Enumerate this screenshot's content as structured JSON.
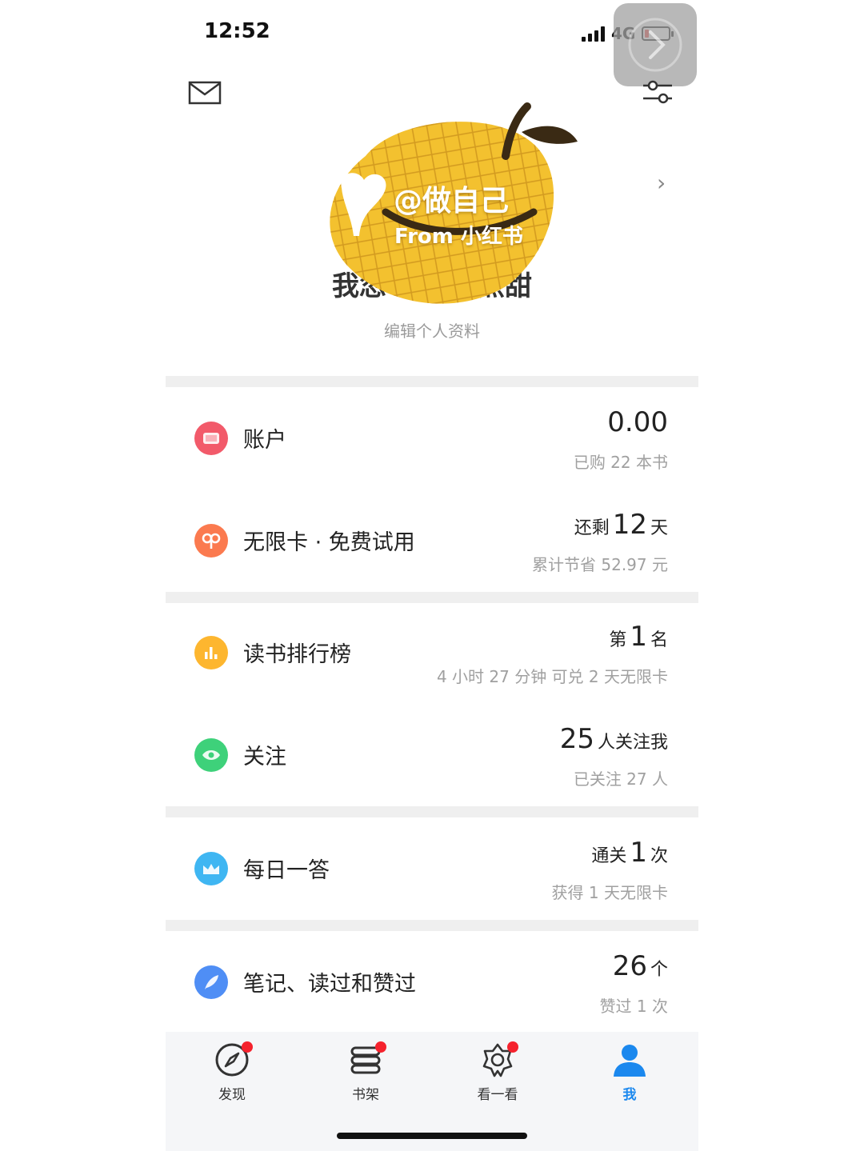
{
  "status_bar": {
    "time": "12:52",
    "network": "4G"
  },
  "profile": {
    "avatar_text_line1": "@做自己",
    "avatar_text_line2": "From 小红书",
    "name_left": "我忽",
    "name_right": "点甜",
    "edit_label": "编辑个人资料"
  },
  "rows": [
    {
      "title": "账户",
      "main_big": "0.00",
      "sub": "已购 22 本书",
      "icon": "wallet-icon",
      "color": "#f25a6a"
    },
    {
      "title": "无限卡 · 免费试用",
      "main_prefix": "还剩",
      "main_big": "12",
      "main_suffix": "天",
      "sub": "累计节省 52.97 元",
      "icon": "infinity-card-icon",
      "color": "#fb7a4f"
    },
    {
      "title": "读书排行榜",
      "main_prefix": "第",
      "main_big": "1",
      "main_suffix": "名",
      "sub": "4 小时 27 分钟  可兑 2 天无限卡",
      "icon": "ranking-icon",
      "color": "#fdb62f"
    },
    {
      "title": "关注",
      "main_big": "25",
      "main_suffix": "人关注我",
      "sub": "已关注 27 人",
      "icon": "eye-icon",
      "color": "#3ed17a"
    },
    {
      "title": "每日一答",
      "main_prefix": "通关",
      "main_big": "1",
      "main_suffix": "次",
      "sub": "获得 1 天无限卡",
      "icon": "crown-icon",
      "color": "#3fb6f2"
    },
    {
      "title": "笔记、读过和赞过",
      "main_big": "26",
      "main_suffix": "个",
      "sub": "赞过 1 次",
      "icon": "feather-icon",
      "color": "#4f8ef5"
    }
  ],
  "tabs": [
    {
      "label": "发现",
      "icon": "compass-icon",
      "badge": true
    },
    {
      "label": "书架",
      "icon": "bookshelf-icon",
      "badge": true
    },
    {
      "label": "看一看",
      "icon": "star-ring-icon",
      "badge": true
    },
    {
      "label": "我",
      "icon": "person-icon",
      "badge": false,
      "active": true
    }
  ],
  "colors": {
    "active_tab": "#1b88ee",
    "badge": "#f5222d",
    "divider": "#efefef"
  }
}
